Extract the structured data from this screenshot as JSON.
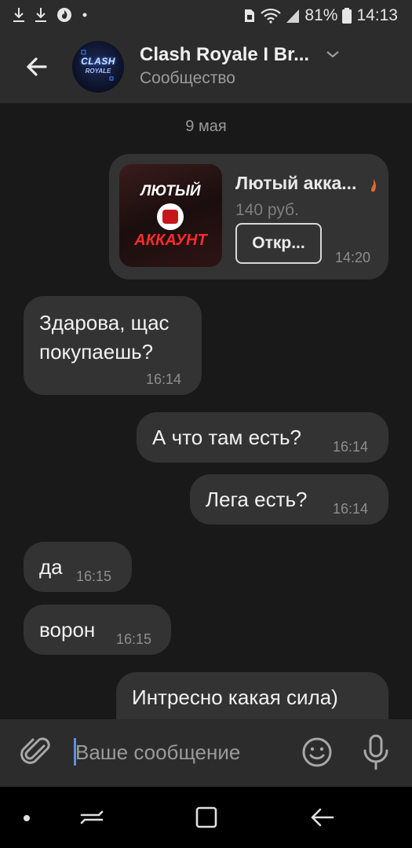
{
  "status_bar": {
    "battery_percent": "81%",
    "time": "14:13",
    "icons": [
      "download-icon",
      "download-icon",
      "fire-app-icon",
      "dot-icon",
      "sim-icon",
      "wifi-icon",
      "signal-icon",
      "battery-icon"
    ]
  },
  "header": {
    "title": "Clash Royale I Br...",
    "subtitle": "Сообщество",
    "avatar_text_line1": "CLASH",
    "avatar_text_line2": "ROYALE"
  },
  "chat": {
    "date_separator": "9 мая",
    "product_card": {
      "image_text_top": "ЛЮТЫЙ",
      "image_text_bottom": "АККАУНТ",
      "title": "Лютый акка...",
      "price": "140 руб.",
      "button_label": "Откр...",
      "time": "14:20"
    },
    "messages": [
      {
        "side": "in",
        "text_lines": [
          "Здарова, щас",
          "покупаешь?"
        ],
        "time": "16:14"
      },
      {
        "side": "out",
        "text": "А что там есть?",
        "time": "16:14"
      },
      {
        "side": "out",
        "text": "Лега есть?",
        "time": "16:14"
      },
      {
        "side": "in",
        "text": "да",
        "time": "16:15"
      },
      {
        "side": "in",
        "text": "ворон",
        "time": "16:15"
      },
      {
        "side": "out",
        "text": "Интресно какая сила)",
        "time": ""
      }
    ]
  },
  "input_bar": {
    "placeholder": "Ваше сообщение"
  },
  "colors": {
    "background": "#191919",
    "bar": "#2c2c2c",
    "bubble": "#333333",
    "caret": "#5d8fe0"
  }
}
